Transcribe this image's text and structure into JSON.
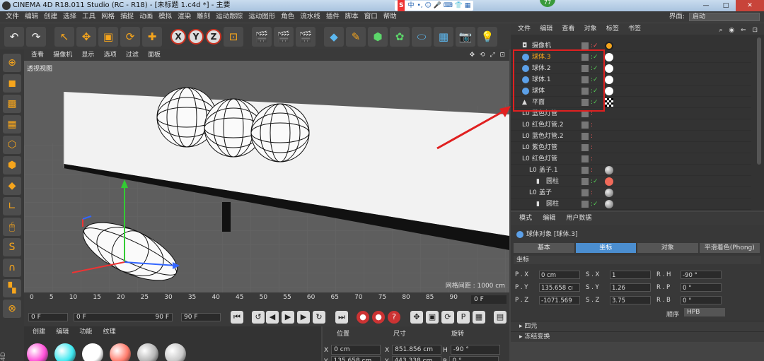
{
  "titlebar": {
    "title": "CINEMA 4D R18.011 Studio (RC - R18) - [未标题 1.c4d *] - 主要",
    "win_min": "—",
    "win_max": "□",
    "win_close": "✕"
  },
  "ime": {
    "s": "S",
    "zh": "中",
    "items": "•, ☺ 🎤 ⌨ 👕 ▦"
  },
  "badge": "77",
  "menubar": {
    "items": [
      "文件",
      "编辑",
      "创建",
      "选择",
      "工具",
      "网格",
      "捕捉",
      "动画",
      "模拟",
      "渲染",
      "雕刻",
      "运动跟踪",
      "运动图形",
      "角色",
      "流水线",
      "插件",
      "脚本",
      "窗口",
      "帮助"
    ],
    "layout_label": "界面:",
    "layout_value": "启动"
  },
  "toolbar": {
    "undo": "↶",
    "redo": "↷",
    "select": "↖",
    "move": "✥",
    "scale": "▣",
    "rotate": "⟳",
    "add": "✚",
    "x": "X",
    "y": "Y",
    "z": "Z",
    "coord": "⊡",
    "render1": "🎬",
    "render2": "🎬",
    "render3": "🎬",
    "cube": "◆",
    "pen": "✎",
    "nurbs": "⬢",
    "array": "✿",
    "deformer": "⬭",
    "floor": "▦",
    "camera": "📷",
    "light": "💡"
  },
  "viewport": {
    "menu": [
      "查看",
      "摄像机",
      "显示",
      "选项",
      "过滤",
      "面板"
    ],
    "nav": "✥ ⟲ ⤢ ⊡",
    "title": "透视视图",
    "grid": "网格间距 : 1000 cm"
  },
  "objman": {
    "menu": [
      "文件",
      "编辑",
      "查看",
      "对象",
      "标签",
      "书签"
    ],
    "icons": "⌕ ◉ ⇐ ⊡",
    "rows": [
      {
        "name": "摄像机",
        "type": "cam",
        "tag": "no",
        "level": 0
      },
      {
        "name": "球体.3",
        "type": "sphere",
        "tag": "white",
        "level": 0
      },
      {
        "name": "球体.2",
        "type": "sphere",
        "tag": "white",
        "level": 0
      },
      {
        "name": "球体.1",
        "type": "sphere",
        "tag": "white",
        "level": 0
      },
      {
        "name": "球体",
        "type": "sphere",
        "tag": "white",
        "level": 0
      },
      {
        "name": "平面",
        "type": "plane",
        "tag": "checker",
        "level": 0
      },
      {
        "name": "蓝色灯管",
        "type": "null",
        "tag": "",
        "level": 0
      },
      {
        "name": "红色灯管.2",
        "type": "null",
        "tag": "",
        "level": 0
      },
      {
        "name": "蓝色灯管.2",
        "type": "null",
        "tag": "",
        "level": 0
      },
      {
        "name": "紫色灯管",
        "type": "null",
        "tag": "",
        "level": 0
      },
      {
        "name": "红色灯管",
        "type": "null",
        "tag": "",
        "level": 0
      },
      {
        "name": "盖子.1",
        "type": "null",
        "tag": "mat",
        "level": 1
      },
      {
        "name": "圆柱",
        "type": "cyl",
        "tag": "red",
        "level": 2
      },
      {
        "name": "盖子",
        "type": "null",
        "tag": "mat",
        "level": 1
      },
      {
        "name": "圆柱",
        "type": "cyl",
        "tag": "mat",
        "level": 2
      }
    ]
  },
  "attrman": {
    "menu": [
      "模式",
      "编辑",
      "用户数据"
    ],
    "title": "球体对象 [球体.3]",
    "tabs": [
      "基本",
      "坐标",
      "对象",
      "平滑着色(Phong)"
    ],
    "section": "坐标",
    "coords": [
      {
        "l": "P . X",
        "v": "0 cm"
      },
      {
        "l": "S . X",
        "v": "1"
      },
      {
        "l": "R . H",
        "v": "-90 °"
      },
      {
        "l": "P . Y",
        "v": "135.658 cı"
      },
      {
        "l": "S . Y",
        "v": "1.26"
      },
      {
        "l": "R . P",
        "v": "0 °"
      },
      {
        "l": "P . Z",
        "v": "-1071.569"
      },
      {
        "l": "S . Z",
        "v": "3.75"
      },
      {
        "l": "R . B",
        "v": "0 °"
      }
    ],
    "order_label": "顺序",
    "order_value": "HPB",
    "collapsed": [
      "四元",
      "冻结变换"
    ]
  },
  "timeline": {
    "ticks": [
      "0",
      "5",
      "10",
      "15",
      "20",
      "25",
      "30",
      "35",
      "40",
      "45",
      "50",
      "55",
      "60",
      "65",
      "70",
      "75",
      "80",
      "85",
      "90"
    ],
    "end": "0 F"
  },
  "transport": {
    "start": "0 F",
    "min": "0 F",
    "max": "90 F",
    "end": "90 F"
  },
  "matman": {
    "menu": [
      "创建",
      "编辑",
      "功能",
      "纹理"
    ],
    "colors": [
      "#ff4fd8",
      "#3ee8f0",
      "#ffffff",
      "#ff7a6a",
      "#b5b5b5",
      "#c8c8c8"
    ]
  },
  "coordman": {
    "headers": [
      "位置",
      "尺寸",
      "旋转"
    ],
    "rows": [
      {
        "a": "X",
        "p": "0 cm",
        "b": "X",
        "s": "851.856 cm",
        "c": "H",
        "r": "-90 °"
      },
      {
        "a": "Y",
        "p": "135.658 cm",
        "b": "Y",
        "s": "443.338 cm",
        "c": "P",
        "r": "0 °"
      }
    ]
  },
  "side": "4D"
}
